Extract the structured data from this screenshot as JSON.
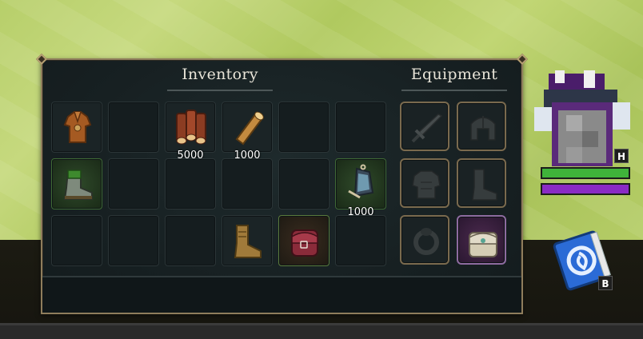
{
  "inventory": {
    "title": "Inventory",
    "rows": [
      [
        {
          "item": "leather-tunic",
          "qty": ""
        },
        {
          "item": "",
          "qty": ""
        },
        {
          "item": "wood-logs-stack",
          "qty": "5000"
        },
        {
          "item": "wood-log",
          "qty": "1000"
        },
        {
          "item": "",
          "qty": ""
        },
        {
          "item": "",
          "qty": ""
        }
      ],
      [
        {
          "item": "iron-boots",
          "qty": ""
        },
        {
          "item": "",
          "qty": ""
        },
        {
          "item": "",
          "qty": ""
        },
        {
          "item": "",
          "qty": ""
        },
        {
          "item": "",
          "qty": ""
        },
        {
          "item": "lantern",
          "qty": "1000"
        }
      ],
      [
        {
          "item": "",
          "qty": ""
        },
        {
          "item": "",
          "qty": ""
        },
        {
          "item": "",
          "qty": ""
        },
        {
          "item": "leather-boots",
          "qty": ""
        },
        {
          "item": "red-backpack",
          "qty": ""
        },
        {
          "item": "",
          "qty": ""
        }
      ]
    ]
  },
  "equipment": {
    "title": "Equipment",
    "slots": [
      "sword",
      "helmet",
      "chest-armor",
      "boots",
      "ring",
      "satchel"
    ]
  },
  "hud": {
    "char_key": "H",
    "book_key": "B",
    "health_fraction": 1.0,
    "mana_fraction": 1.0,
    "health_color": "#3fb33a",
    "mana_color": "#8a2bc4"
  }
}
